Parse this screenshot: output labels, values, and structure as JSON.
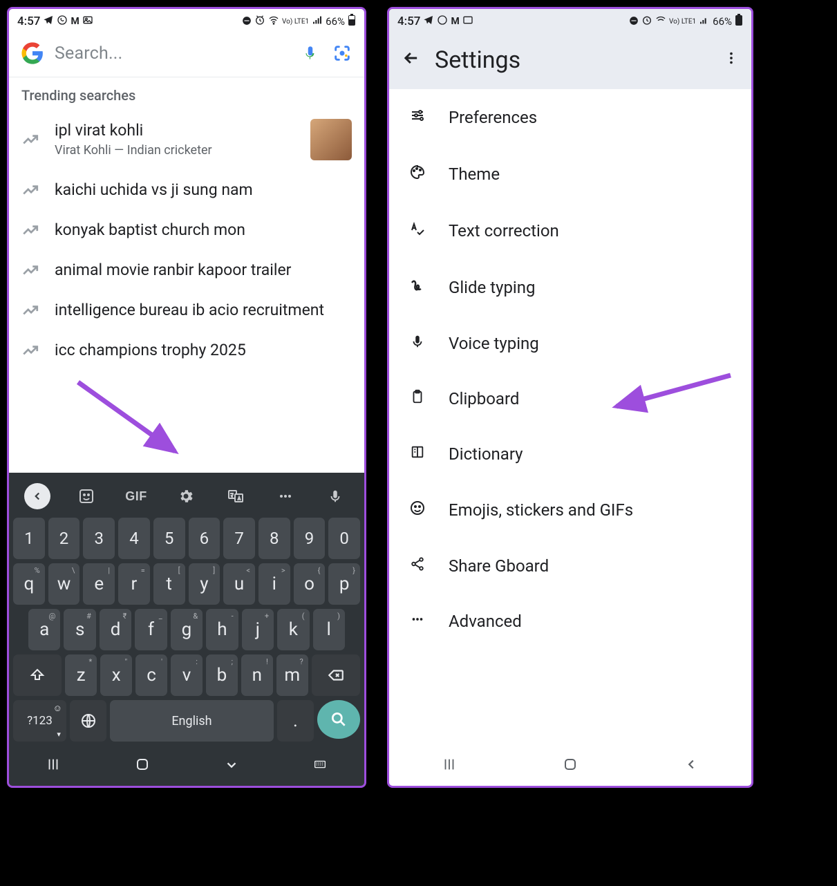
{
  "status_bar": {
    "time": "4:57",
    "battery_pct": "66%",
    "network_label": "Vo) LTE1"
  },
  "left_screen": {
    "search_placeholder": "Search...",
    "trending_label": "Trending searches",
    "trending": [
      {
        "title": "ipl virat kohli",
        "subtitle": "Virat Kohli — Indian cricketer",
        "has_thumb": true
      },
      {
        "title": "kaichi uchida vs ji sung nam"
      },
      {
        "title": "konyak baptist church mon"
      },
      {
        "title": "animal movie ranbir kapoor trailer"
      },
      {
        "title": "intelligence bureau ib acio recruitment"
      },
      {
        "title": "icc champions trophy 2025"
      }
    ],
    "keyboard": {
      "gif_label": "GIF",
      "row_numbers": [
        "1",
        "2",
        "3",
        "4",
        "5",
        "6",
        "7",
        "8",
        "9",
        "0"
      ],
      "row_top": [
        "q",
        "w",
        "e",
        "r",
        "t",
        "y",
        "u",
        "i",
        "o",
        "p"
      ],
      "row_top_hints": [
        "%",
        "\\",
        "|",
        "=",
        "[",
        "]",
        "<",
        ">",
        "{",
        "}"
      ],
      "row_mid": [
        "a",
        "s",
        "d",
        "f",
        "g",
        "h",
        "j",
        "k",
        "l"
      ],
      "row_mid_hints": [
        "@",
        "#",
        "₹",
        "_",
        "&",
        "-",
        "+",
        "(",
        ")"
      ],
      "row_bottom": [
        "z",
        "x",
        "c",
        "v",
        "b",
        "n",
        "m"
      ],
      "row_bottom_hints": [
        "*",
        "\"",
        "'",
        ":",
        ";",
        "!",
        "?"
      ],
      "symbols_key": "?123",
      "space_label": "English",
      "period_key": "."
    }
  },
  "right_screen": {
    "title": "Settings",
    "items": [
      {
        "icon": "tune-icon",
        "label": "Preferences"
      },
      {
        "icon": "palette-icon",
        "label": "Theme"
      },
      {
        "icon": "spellcheck-icon",
        "label": "Text correction"
      },
      {
        "icon": "gesture-icon",
        "label": "Glide typing"
      },
      {
        "icon": "mic-icon",
        "label": "Voice typing"
      },
      {
        "icon": "clipboard-icon",
        "label": "Clipboard"
      },
      {
        "icon": "book-icon",
        "label": "Dictionary"
      },
      {
        "icon": "smiley-icon",
        "label": "Emojis, stickers and GIFs"
      },
      {
        "icon": "share-icon",
        "label": "Share Gboard"
      },
      {
        "icon": "dots-icon",
        "label": "Advanced"
      }
    ]
  },
  "annotation": {
    "arrow_color": "#9d4edd"
  }
}
